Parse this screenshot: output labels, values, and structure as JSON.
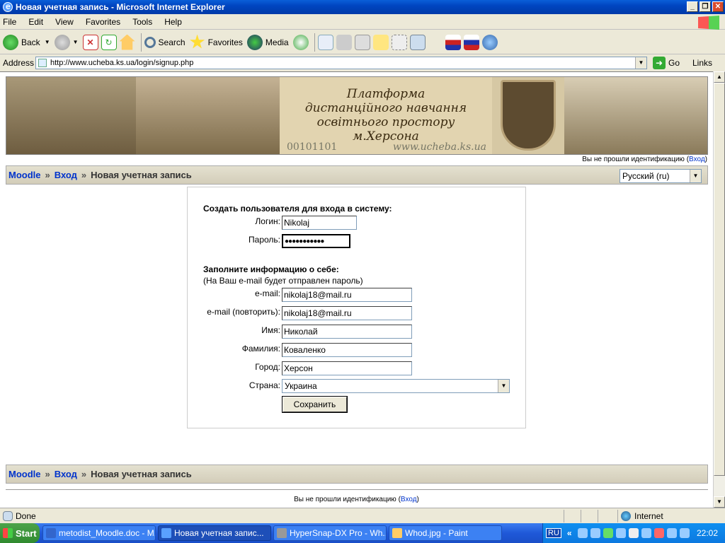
{
  "window": {
    "title": "Новая учетная запись - Microsoft Internet Explorer"
  },
  "menu": [
    "File",
    "Edit",
    "View",
    "Favorites",
    "Tools",
    "Help"
  ],
  "toolbar": {
    "back": "Back",
    "search": "Search",
    "favorites": "Favorites",
    "media": "Media"
  },
  "address": {
    "label": "Address",
    "url": "http://www.ucheba.ks.ua/login/signup.php",
    "go": "Go",
    "links": "Links"
  },
  "banner": {
    "title_line1": "Платформа",
    "title_line2": "дистанційного навчання",
    "title_line3": "освітнього простору",
    "title_line4": "м.Херсона",
    "binary": "00101101",
    "url": "www.ucheba.ks.ua"
  },
  "auth_top": {
    "text": "Вы не прошли идентификацию (",
    "link": "Вход",
    "close": ")"
  },
  "breadcrumb": {
    "home": "Moodle",
    "sep": "»",
    "login": "Вход",
    "current": "Новая учетная запись"
  },
  "language": {
    "selected": "Русский (ru)"
  },
  "form": {
    "section1": "Создать пользователя для входа в систему:",
    "login_label": "Логин:",
    "login_value": "Nikolaj",
    "password_label": "Пароль:",
    "password_value": "●●●●●●●●●●●",
    "section2": "Заполните информацию о себе:",
    "section2_note": "(На Ваш e-mail будет отправлен пароль)",
    "email_label": "e-mail:",
    "email_value": "nikolaj18@mail.ru",
    "email2_label": "e-mail (повторить):",
    "email2_value": "nikolaj18@mail.ru",
    "name_label": "Имя:",
    "name_value": "Николай",
    "surname_label": "Фамилия:",
    "surname_value": "Коваленко",
    "city_label": "Город:",
    "city_value": "Херсон",
    "country_label": "Страна:",
    "country_value": "Украина",
    "submit": "Сохранить"
  },
  "status": {
    "text": "Done",
    "zone": "Internet"
  },
  "taskbar": {
    "start": "Start",
    "tasks": [
      "metodist_Moodle.doc - M...",
      "Новая учетная запис...",
      "HyperSnap-DX Pro - Wh...",
      "Whod.jpg - Paint"
    ],
    "lang": "RU",
    "time": "22:02"
  }
}
